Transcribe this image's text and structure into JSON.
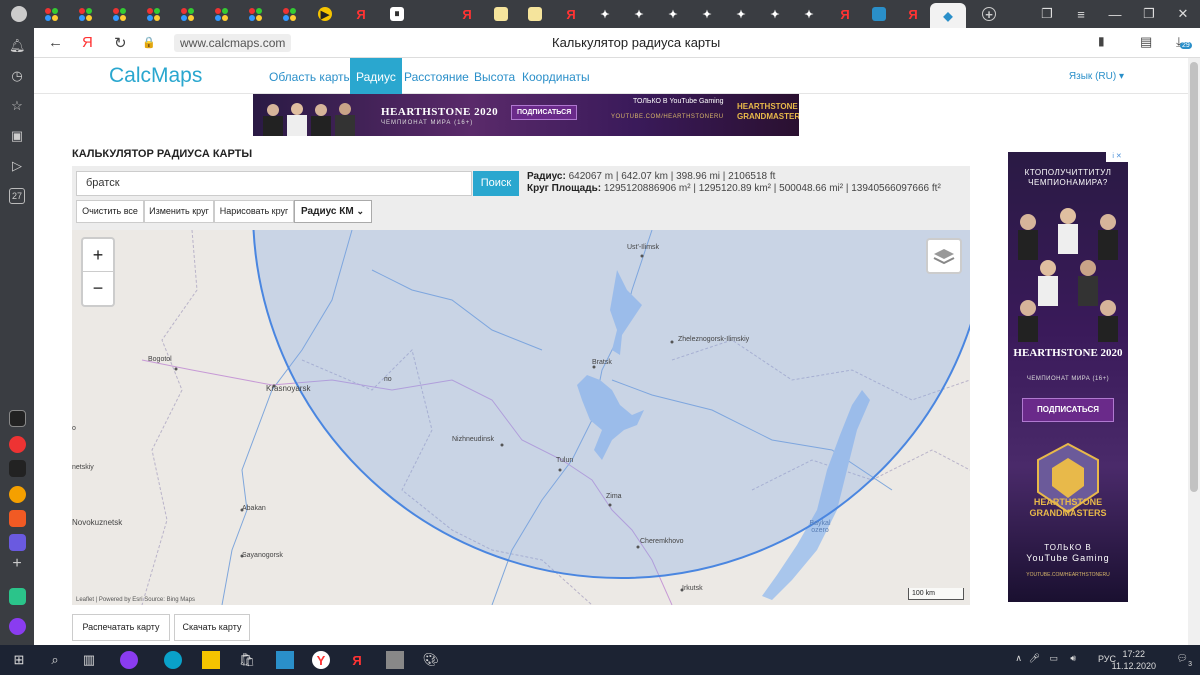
{
  "browser": {
    "page_title": "Калькулятор радиуса карты",
    "url": "www.calcmaps.com",
    "notif_count": "29",
    "left_badge": "27"
  },
  "site": {
    "logo": "CalcMaps",
    "nav": [
      "Область карты",
      "Радиус",
      "Расстояние",
      "Высота",
      "Координаты"
    ],
    "lang": "Язык (RU)",
    "heading": "КАЛЬКУЛЯТОР РАДИУСА КАРТЫ"
  },
  "banner": {
    "title": "HEARTHSTONE 2020",
    "subtitle": "ЧЕМПИОНАТ МИРА (16+)",
    "subscribe": "ПОДПИСАТЬСЯ",
    "youtube": "YOUTUBE.COM/HEARTHSTONERU",
    "only_on": "ТОЛЬКО В",
    "yt_gaming": "YouTube Gaming",
    "logo_text": "HEARTHSTONE GRANDMASTERS"
  },
  "tools": {
    "search_value": "братск",
    "search_btn": "Поиск",
    "clear_all": "Очистить все",
    "edit_circle": "Изменить круг",
    "draw_circle": "Нарисовать круг",
    "radius_select": "Радиус КМ"
  },
  "info": {
    "radius_label": "Радиус:",
    "radius_value": "642067 m | 642.07 km | 398.96 mi | 2106518 ft",
    "area_label": "Круг Площадь:",
    "area_value": "1295120886906 m² | 1295120.89 km² | 500048.66 mi² | 13940566097666 ft²"
  },
  "map": {
    "zoom_in": "+",
    "zoom_out": "−",
    "attribution": "Leaflet | Powered by Esri Source: Bing Maps",
    "scale": "100 km",
    "labels": {
      "ust_ilimsk": "Ust'-Ilimsk",
      "zheleznogorsk": "Zheleznogorsk-Ilimskiy",
      "bratsk": "Bratsk",
      "bogotol": "Bogotol",
      "krasnoyarsk": "Krasnoyarsk",
      "nizhneudinsk": "Nizhneudinsk",
      "tulun": "Tulun",
      "zima": "Zima",
      "cheremkhovo": "Cheremkhovo",
      "irkutsk": "Irkutsk",
      "abakan": "Abakan",
      "sayanogorsk": "Sayanogorsk",
      "novokuznetsk": "Novokuznetsk",
      "netskiy": "netskiy",
      "baykal": "Baykal ozero",
      "lo": "по",
      "o": "o"
    }
  },
  "bottom": {
    "print": "Распечатать карту",
    "download": "Скачать карту"
  },
  "sidead": {
    "question": "КТОПОЛУЧИТТИТУЛ ЧЕМПИОНАМИРА?",
    "title": "HEARTHSTONE 2020",
    "champ": "ЧЕМПИОНАТ МИРА (16+)",
    "subscribe": "ПОДПИСАТЬСЯ",
    "gm": "HEARTHSTONE GRANDMASTERS",
    "only": "ТОЛЬКО В",
    "yt": "YouTube Gaming",
    "url": "YOUTUBE.COM/HEARTHSTONERU",
    "ad": "i ✕"
  },
  "taskbar": {
    "time": "17:22",
    "date": "11.12.2020",
    "lang": "РУС",
    "notif": "3"
  },
  "colors": {
    "accent": "#2aa7cf",
    "circle_fill": "#7fa8e6",
    "circle_stroke": "#4a86e0",
    "water": "#a9c6ec"
  }
}
